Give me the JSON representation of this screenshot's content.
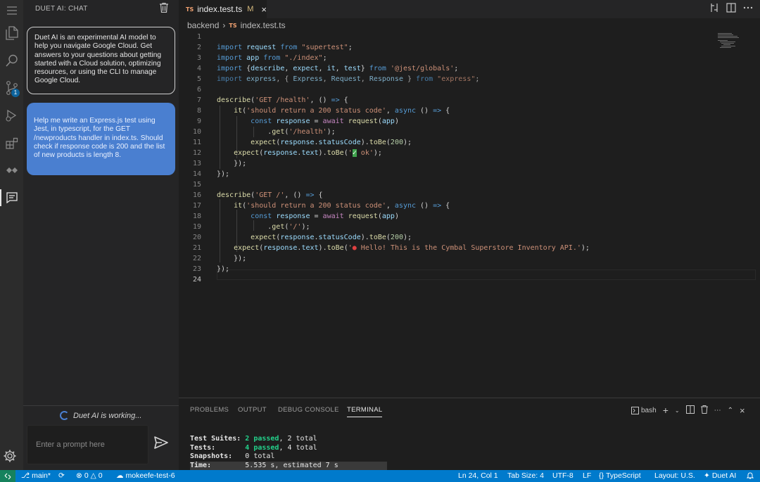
{
  "sidebar": {
    "header": "DUET AI: CHAT",
    "intro_message": "Duet AI is an experimental AI model to help you navigate Google Cloud. Get answers to your questions about getting started with a Cloud solution, optimizing resources, or using the CLI to manage Google Cloud.",
    "user_message": "Help me write an Express.js test using Jest, in typescript, for the GET /newproducts handler in index.ts. Should check if response code is 200 and the list of new products is length 8.",
    "working_status": "Duet AI is working...",
    "prompt_placeholder": "Enter a prompt here"
  },
  "activity_bar": {
    "source_control_badge": "1"
  },
  "editor": {
    "tab": {
      "badge": "TS",
      "filename": "index.test.ts",
      "modified": "M"
    },
    "breadcrumb": {
      "folder": "backend",
      "badge": "TS",
      "file": "index.test.ts"
    },
    "line_numbers": [
      "1",
      "2",
      "3",
      "4",
      "5",
      "6",
      "7",
      "8",
      "9",
      "10",
      "11",
      "12",
      "13",
      "14",
      "15",
      "16",
      "17",
      "18",
      "19",
      "20",
      "21",
      "22",
      "23",
      "24"
    ]
  },
  "panel": {
    "tabs": [
      "PROBLEMS",
      "OUTPUT",
      "DEBUG CONSOLE",
      "TERMINAL"
    ],
    "active_tab": "TERMINAL",
    "shell": "bash",
    "terminal": {
      "suites_label": "Test Suites:",
      "suites_passed": "2 passed",
      "suites_total": ", 2 total",
      "tests_label": "Tests:",
      "tests_passed": "4 passed",
      "tests_total": ", 4 total",
      "snapshots_label": "Snapshots:",
      "snapshots_value": "0 total",
      "time_label": "Time:",
      "time_value": "5.535 s, estimated 7 s"
    }
  },
  "statusbar": {
    "branch": "main*",
    "errors": "0",
    "warnings": "0",
    "project": "mokeefe-test-6",
    "position": "Ln 24, Col 1",
    "tab_size": "Tab Size: 4",
    "encoding": "UTF-8",
    "eol": "LF",
    "language": "TypeScript",
    "layout": "Layout: U.S.",
    "duet": "Duet AI"
  },
  "colors": {
    "accent": "#007acc",
    "remote": "#16825d",
    "user_bubble": "#4a7fd0",
    "passed": "#23d18b"
  }
}
